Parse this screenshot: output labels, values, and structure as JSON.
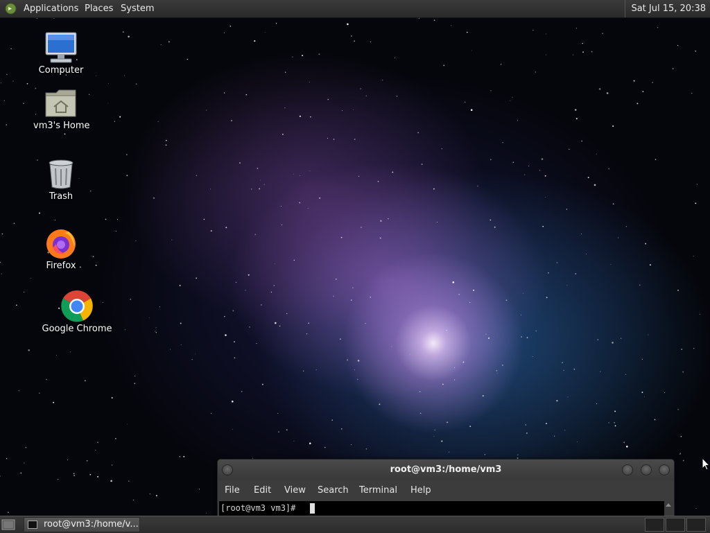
{
  "top_panel": {
    "menus": [
      "Applications",
      "Places",
      "System"
    ],
    "clock": "Sat Jul 15, 20:38"
  },
  "desktop": {
    "icons": [
      {
        "label": "Computer",
        "icon": "computer-icon"
      },
      {
        "label": "vm3's Home",
        "icon": "home-folder-icon"
      },
      {
        "label": "Trash",
        "icon": "trash-icon"
      },
      {
        "label": "Firefox",
        "icon": "firefox-icon"
      },
      {
        "label": "Google Chrome",
        "icon": "chrome-icon"
      }
    ]
  },
  "terminal": {
    "title": "root@vm3:/home/vm3",
    "menus": [
      "File",
      "Edit",
      "View",
      "Search",
      "Terminal",
      "Help"
    ],
    "prompt": "[root@vm3 vm3]#"
  },
  "bottom_panel": {
    "task_label": "root@vm3:/home/v..."
  }
}
